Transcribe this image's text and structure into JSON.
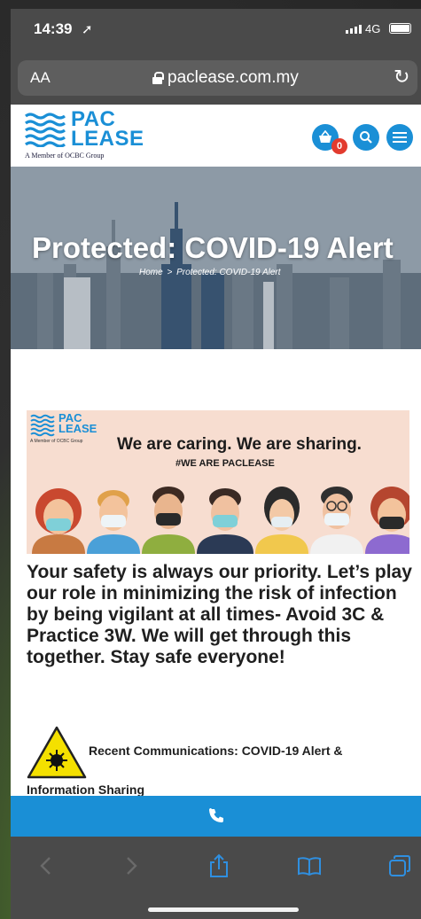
{
  "status_bar": {
    "time": "14:39",
    "network": "4G",
    "location_icon": "location-arrow-icon"
  },
  "browser": {
    "text_size_label": "AA",
    "url": "paclease.com.my",
    "reload_icon": "reload-icon"
  },
  "site": {
    "logo_line1": "PAC",
    "logo_line2": "LEASE",
    "logo_member": "A Member of OCBC Group",
    "cart_count": "0",
    "brand_color": "#1a8fd6",
    "badge_color": "#e23b2e"
  },
  "hero": {
    "title": "Protected: COVID-19 Alert",
    "breadcrumb_home": "Home",
    "breadcrumb_sep": ">",
    "breadcrumb_current": "Protected: COVID-19 Alert"
  },
  "banner": {
    "logo_line1": "PAC",
    "logo_line2": "LEASE",
    "logo_member": "A Member of OCBC Group",
    "tagline": "We are caring. We are sharing.",
    "hashtag": "#WE ARE PACLEASE"
  },
  "content": {
    "message": "Your safety is always our priority. Let’s play our role in minimizing the risk of infection by being vigilant at all times- Avoid 3C & Practice 3W. We will get through this together. Stay safe everyone!",
    "recent_line1": "Recent Communications: COVID-19 Alert &",
    "recent_line2": "Information Sharing"
  },
  "callbar": {
    "icon": "phone-icon"
  },
  "toolbar": {
    "icons": [
      "back-icon",
      "forward-icon",
      "share-icon",
      "bookmarks-icon",
      "tabs-icon"
    ]
  }
}
